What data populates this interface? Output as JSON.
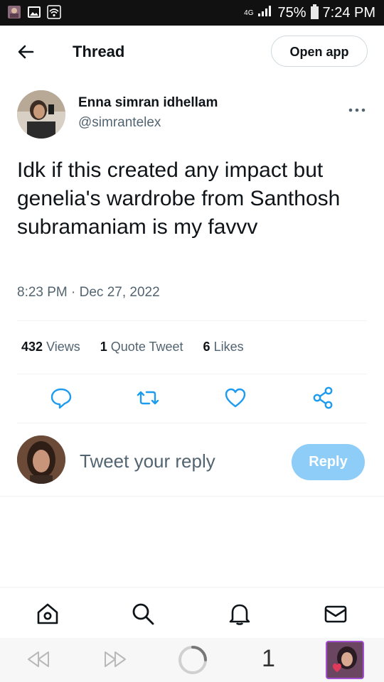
{
  "status_bar": {
    "network": "4G",
    "battery": "75%",
    "time": "7:24 PM"
  },
  "header": {
    "title": "Thread",
    "open_app_label": "Open app"
  },
  "tweet": {
    "author_name": "Enna simran idhellam",
    "author_handle": "@simrantelex",
    "text": "Idk if this created any impact but genelia's wardrobe from Santhosh subramaniam is my favvv",
    "timestamp": "8:23 PM · Dec 27, 2022",
    "stats": {
      "views_count": "432",
      "views_label": "Views",
      "quotes_count": "1",
      "quotes_label": "Quote Tweet",
      "likes_count": "6",
      "likes_label": "Likes"
    }
  },
  "reply": {
    "placeholder": "Tweet your reply",
    "button_label": "Reply"
  },
  "browser": {
    "tab_count": "1"
  },
  "colors": {
    "accent": "#1d9bf0",
    "reply_button": "#8ecdf7",
    "secondary_text": "#536471"
  }
}
